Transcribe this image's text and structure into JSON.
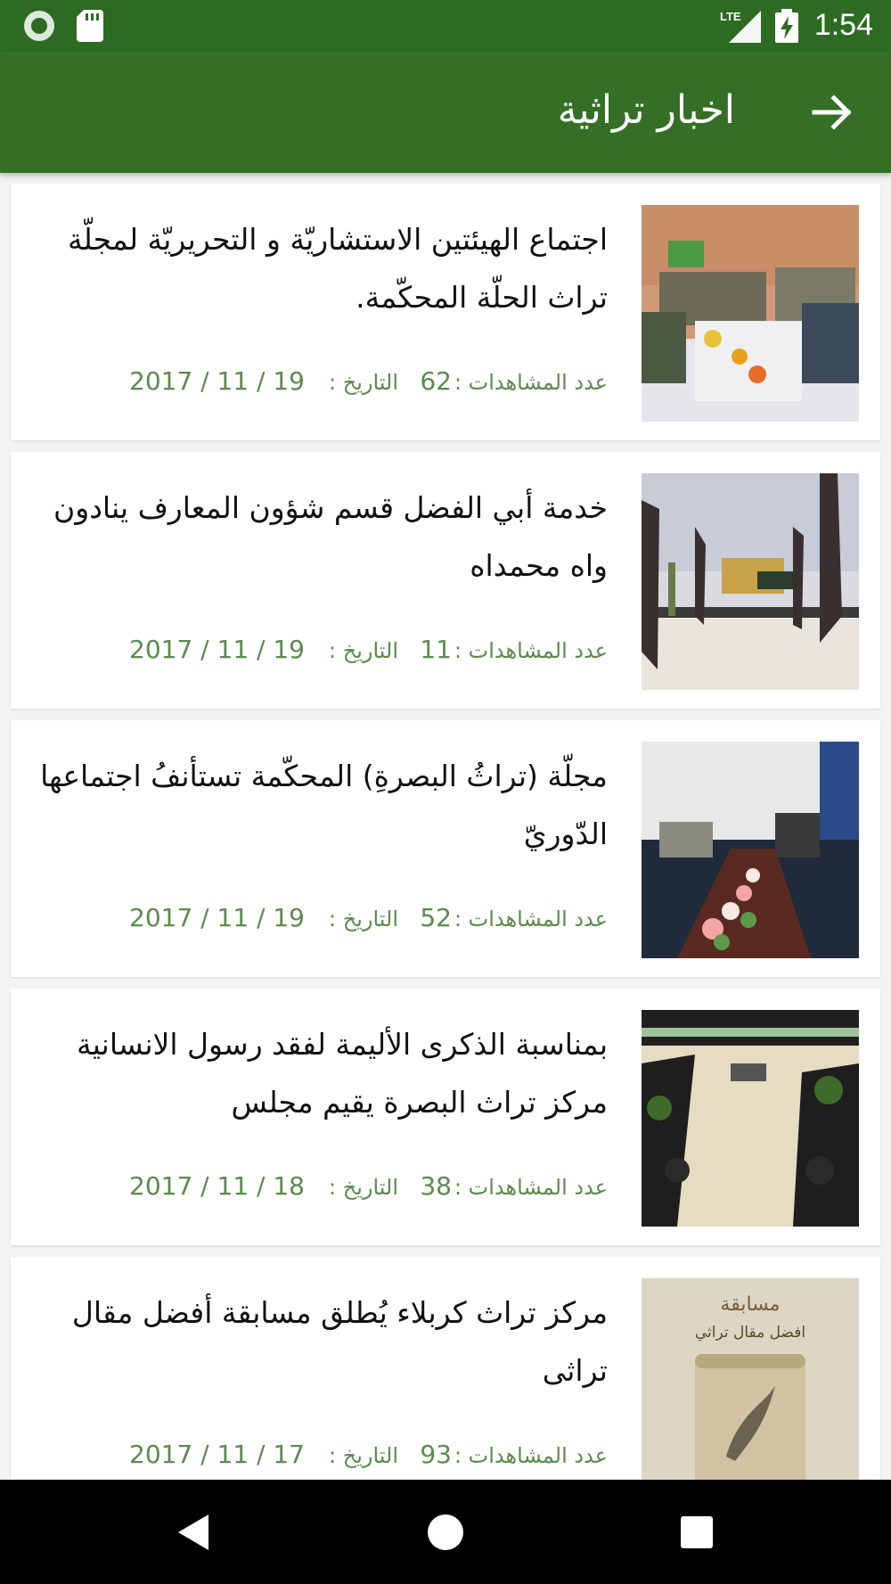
{
  "status_bar": {
    "time": "1:54",
    "network": "LTE",
    "icons": [
      "circle-icon",
      "sd-card-icon",
      "lte-signal-icon",
      "battery-charging-icon"
    ]
  },
  "app_bar": {
    "title": "اخبار تراثية",
    "back_icon": "arrow-right-icon"
  },
  "news": [
    {
      "headline": "اجتماع الهيئتين الاستشاريّة و التحريريّة لمجلّة تراث الحلّة المحكّمة.",
      "views_label": "عدد المشاهدات :",
      "views": "62",
      "date_label": "التاريخ :",
      "date": "2017 / 11 / 19"
    },
    {
      "headline": "خدمة أبي الفضل قسم شؤون المعارف ينادون واه محمداه",
      "views_label": "عدد المشاهدات :",
      "views": "11",
      "date_label": "التاريخ :",
      "date": "2017 / 11 / 19"
    },
    {
      "headline": "مجلّة (تراثُ البصرةِ) المحكّمة تستأنفُ اجتماعها الدّوريّ",
      "views_label": "عدد المشاهدات :",
      "views": "52",
      "date_label": "التاريخ :",
      "date": "2017 / 11 / 19"
    },
    {
      "headline": "بمناسبة الذكرى الأليمة لفقد رسول الانسانية مركز تراث البصرة يقيم مجلس",
      "views_label": "عدد المشاهدات :",
      "views": "38",
      "date_label": "التاريخ :",
      "date": "2017 / 11 / 18"
    },
    {
      "headline": "مركز تراث كربلاء يُطلق مسابقة أفضل مقال تراثى",
      "views_label": "عدد المشاهدات :",
      "views": "93",
      "date_label": "التاريخ :",
      "date": "2017 / 11 / 17",
      "thumb_text": {
        "line1": "مسابقة",
        "line2": "افضل مقال تراثي"
      }
    }
  ],
  "nav_bar": {
    "icons": [
      "back-triangle-icon",
      "home-circle-icon",
      "recents-square-icon"
    ]
  },
  "colors": {
    "status_bar": "#2e6b22",
    "app_bar": "#356f26",
    "meta_text": "#5c8a4d",
    "background": "#f3f3f3"
  }
}
